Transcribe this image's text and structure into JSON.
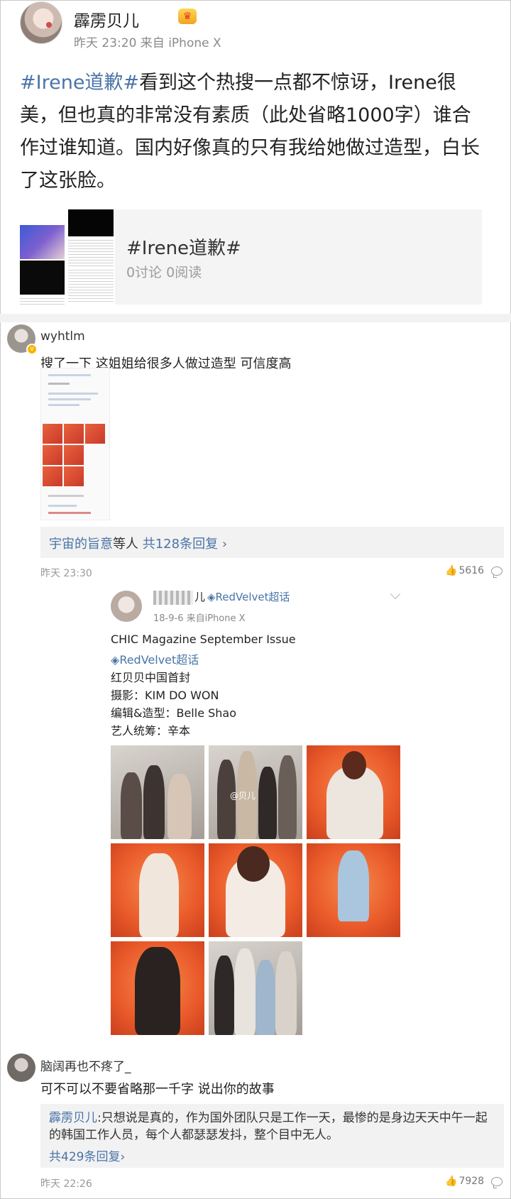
{
  "post": {
    "author": "霹雳贝儿",
    "badge": "♛",
    "meta": "昨天 23:20 来自 iPhone X",
    "hashtag": "#Irene道歉#",
    "text": "看到这个热搜一点都不惊讶，Irene很美，但也真的非常没有素质（此处省略1000字）谁合作过谁知道。国内好像真的只有我给她做过造型，白长了这张脸。",
    "topic_card": {
      "title": "#Irene道歉#",
      "stats": "0讨论 0阅读"
    }
  },
  "comments": [
    {
      "user": "wyhtlm",
      "verified_mark": "v",
      "text": "搜了一下 这姐姐给很多人做过造型 可信度高",
      "replies_prefix": "宇宙的旨意",
      "replies_middle": "等人",
      "replies_count": "共128条回复",
      "replies_arrow": "›",
      "time": "昨天 23:30",
      "likes": "5616",
      "embedded_post": {
        "name_tail": "儿",
        "tag": "RedVelvet超话",
        "meta": "18-9-6 来自iPhone X",
        "lines": [
          "CHIC Magazine September Issue",
          "RedVelvet超话",
          "红贝贝中国首封",
          "摄影：KIM DO WON",
          "编辑&造型：Belle Shao",
          "艺人统筹：辛本"
        ],
        "photo_watermark": "@贝儿"
      }
    },
    {
      "user": "脑阔再也不疼了_",
      "text": "可不可以不要省略那一千字 说出你的故事",
      "reply": {
        "author": "霹雳贝儿",
        "text": ":只想说是真的，作为国外团队只是工作一天，最惨的是身边天天中午一起的韩国工作人员，每个人都瑟瑟发抖，整个目中无人。",
        "count": "共429条回复",
        "arrow": "›"
      },
      "time": "昨天 22:26",
      "likes": "7928"
    }
  ],
  "icons": {
    "like": "thumbs-up-icon",
    "comment": "comment-bubble-icon",
    "verified": "verified-badge-icon",
    "crown": "vip-crown-icon",
    "diamond": "diamond-icon"
  },
  "colors": {
    "link_blue": "#4a74a8",
    "meta_grey": "#8a8a8a",
    "reply_bg": "#f2f2f2",
    "vip_gold": "#f1a51c"
  }
}
